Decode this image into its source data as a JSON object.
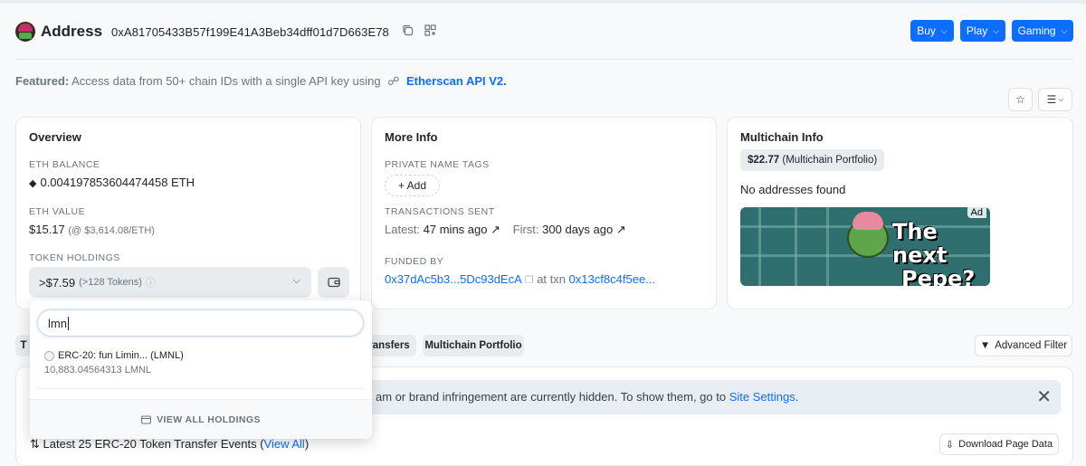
{
  "header": {
    "label": "Address",
    "address": "0xA81705433B57f199E41A3Beb34dff01d7D663E78",
    "menu_buttons": [
      "Buy",
      "Play",
      "Gaming"
    ]
  },
  "featured": {
    "prefix": "Featured:",
    "text": "Access data from 50+ chain IDs with a single API key using",
    "link": "Etherscan API V2."
  },
  "overview": {
    "title": "Overview",
    "eth_balance_label": "ETH BALANCE",
    "eth_balance": "0.004197853604474458 ETH",
    "eth_value_label": "ETH VALUE",
    "eth_value": "$15.17",
    "eth_price": "(@ $3,614.08/ETH)",
    "token_holdings_label": "TOKEN HOLDINGS",
    "token_value": ">$7.59",
    "token_count": "(>128 Tokens)"
  },
  "more_info": {
    "title": "More Info",
    "private_tags_label": "PRIVATE NAME TAGS",
    "add_label": "+ Add",
    "tx_sent_label": "TRANSACTIONS SENT",
    "latest_label": "Latest:",
    "latest_value": "47 mins ago",
    "first_label": "First:",
    "first_value": "300 days ago",
    "funded_by_label": "FUNDED BY",
    "funded_by": "0x37dAc5b3...5Dc93dEcA",
    "at_txn_label": "at txn",
    "txn": "0x13cf8c4f5ee..."
  },
  "multichain": {
    "title": "Multichain Info",
    "portfolio_value": "$22.77",
    "portfolio_label": "(Multichain Portfolio)",
    "no_addresses": "No addresses found",
    "ad_text_line1": "The next",
    "ad_text_line2": "Pepe?",
    "ad_badge": "Ad"
  },
  "tabs": {
    "tab1_partial": "T",
    "tab2_partial": "ransfers",
    "multichain_portfolio": "Multichain Portfolio",
    "advanced_filter": "Advanced Filter"
  },
  "alert": {
    "text": "am or brand infringement are currently hidden. To show them, go to",
    "link": "Site Settings",
    "suffix": "."
  },
  "latest_events": {
    "text": "Latest 25 ERC-20 Token Transfer Events (",
    "link": "View All",
    "suffix": ")",
    "download": "Download Page Data"
  },
  "dropdown": {
    "search_value": "lmn",
    "item_name": "ERC-20: fun Limin... (LMNL)",
    "item_amount": "10,883.04564313 LMNL",
    "view_all": "VIEW ALL HOLDINGS"
  },
  "colors": {
    "accent": "#0d6efd",
    "page_bg": "#f8f9fa",
    "muted": "#6c757d"
  }
}
